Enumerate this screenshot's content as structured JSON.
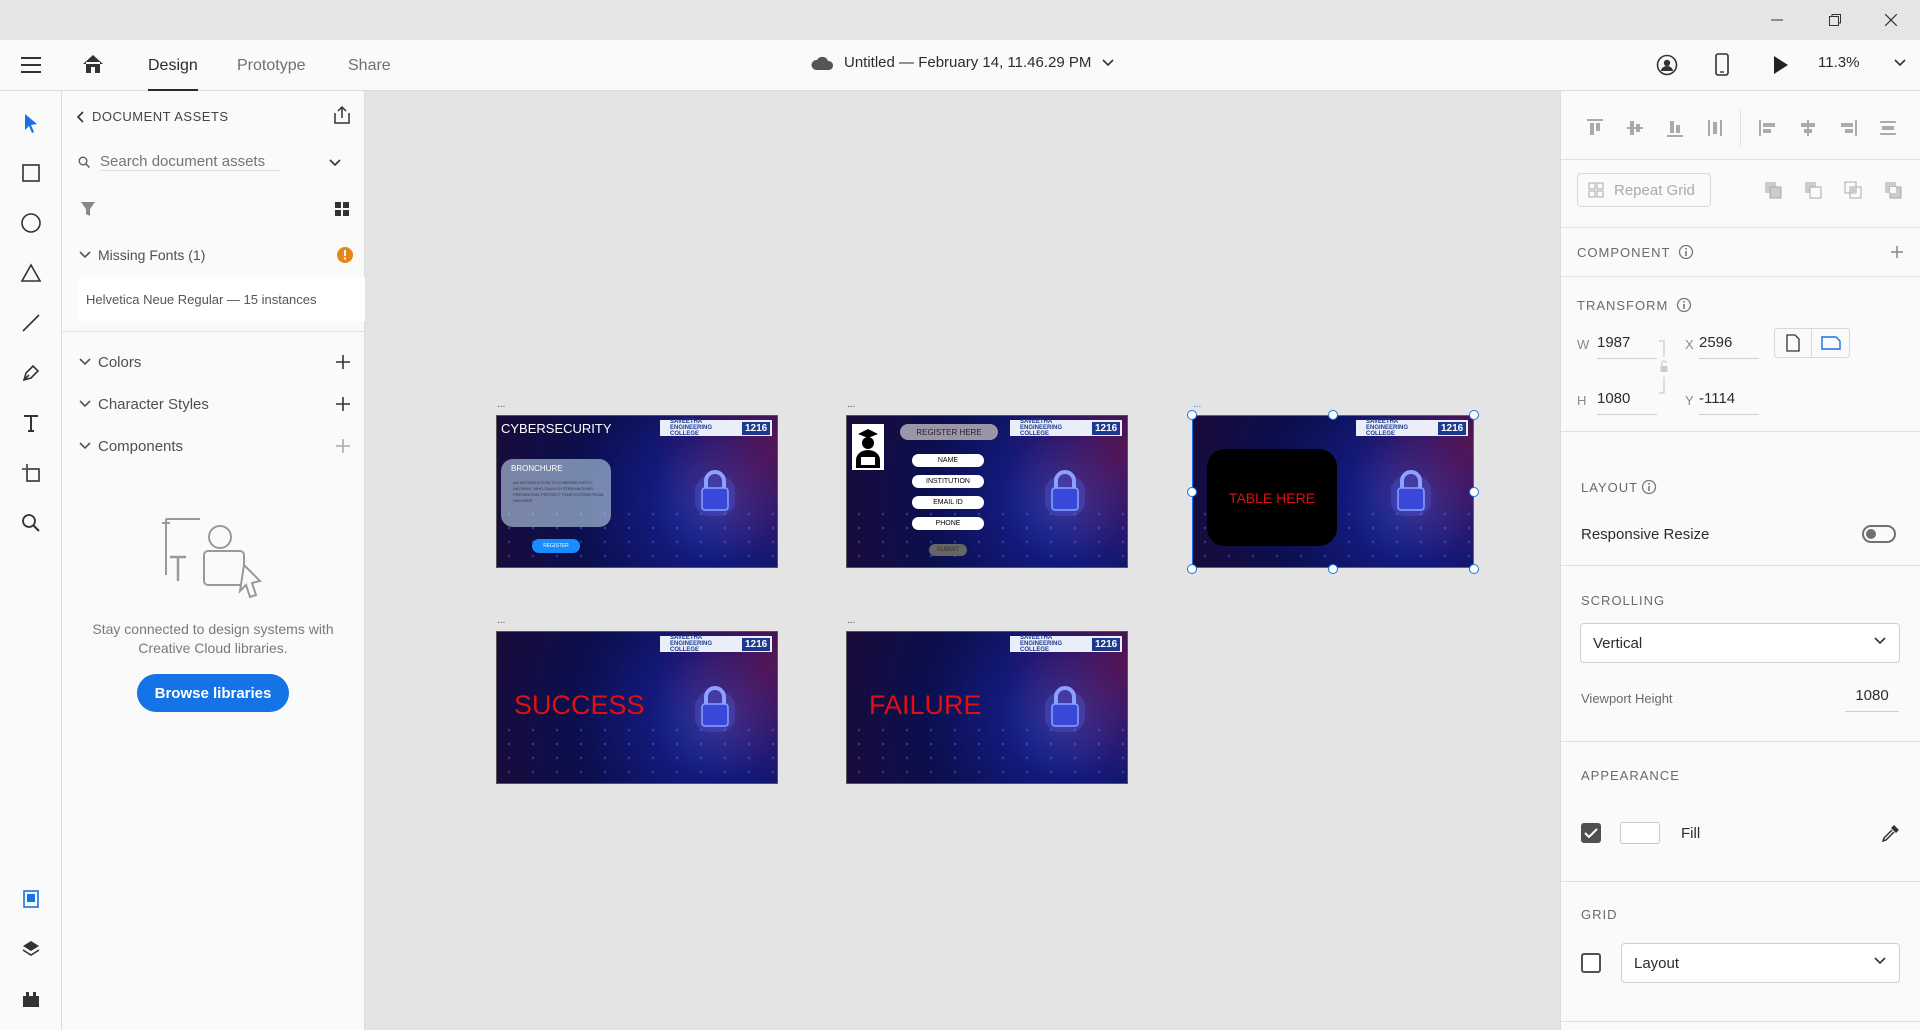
{
  "window": {
    "minimize": "—",
    "maximize": "☐",
    "close": "✕"
  },
  "topbar": {
    "tabs": [
      "Design",
      "Prototype",
      "Share"
    ],
    "doc_title": "Untitled — February 14, 11.46.29 PM",
    "zoom": "11.3%"
  },
  "assets": {
    "header": "DOCUMENT ASSETS",
    "search_placeholder": "Search document assets",
    "missing_fonts": "Missing Fonts (1)",
    "missing_font_item": "Helvetica Neue Regular — 15 instances",
    "sections": [
      "Colors",
      "Character Styles",
      "Components"
    ],
    "cc_message": "Stay connected to design systems with Creative Cloud libraries.",
    "browse_button": "Browse libraries"
  },
  "canvas": {
    "artboard_label": "...",
    "logo_text": "SAVEETHA ENGINEERING COLLEGE",
    "logo_number": "1216",
    "ab1": {
      "title": "CYBERSECURITY",
      "card_title": "BRONCHURE",
      "card_text": "AN INTRODUCTION TO CYBERSECURITY, HACKING, WHO CAN A SYSTEM HACKING PREVENTION, PROTECT YOUR SYSTEM FROM HACKERS",
      "button": "REGISTER"
    },
    "ab2": {
      "header": "REGISTER HERE",
      "fields": [
        "NAME",
        "INSTITUTION",
        "EMAIL ID",
        "PHONE"
      ],
      "submit": "SUBMIT"
    },
    "ab3": {
      "table": "TABLE HERE"
    },
    "ab4": {
      "text": "SUCCESS"
    },
    "ab5": {
      "text": "FAILURE"
    }
  },
  "props": {
    "repeat_grid": "Repeat Grid",
    "component": "COMPONENT",
    "transform": "TRANSFORM",
    "w_label": "W",
    "w": "1987",
    "h_label": "H",
    "h": "1080",
    "x_label": "X",
    "x": "2596",
    "y_label": "Y",
    "y": "-1114",
    "layout": "LAYOUT",
    "responsive_resize": "Responsive Resize",
    "scrolling": "SCROLLING",
    "scrolling_value": "Vertical",
    "viewport_height_label": "Viewport Height",
    "viewport_height": "1080",
    "appearance": "APPEARANCE",
    "fill_label": "Fill",
    "grid": "GRID",
    "grid_value": "Layout"
  },
  "colors": {
    "accent": "#1473e6",
    "alert": "#e68619",
    "danger": "#e01010"
  }
}
